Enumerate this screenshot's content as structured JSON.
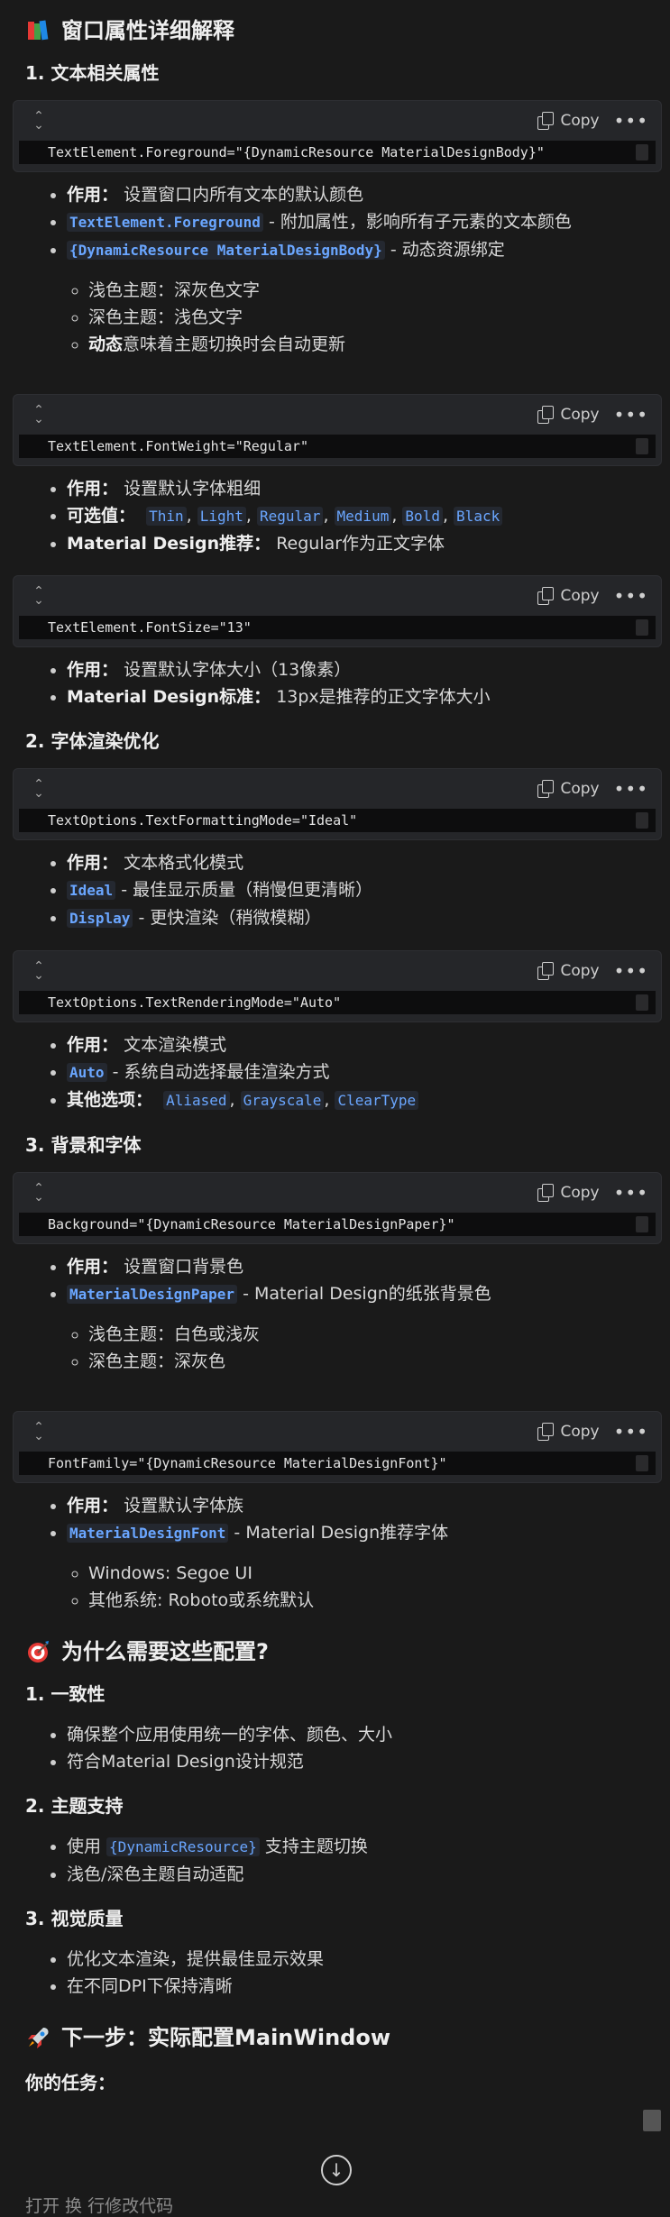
{
  "title": "窗口属性详细解释",
  "sections": {
    "s1": "1. 文本相关属性",
    "s2": "2. 字体渲染优化",
    "s3": "3. 背景和字体"
  },
  "code_ui": {
    "copy": "Copy",
    "more": "•••",
    "collapse": "⌄⌃"
  },
  "blocks": [
    {
      "code": "TextElement.Foreground=\"{DynamicResource MaterialDesignBody}\"",
      "items": [
        {
          "label": "作用：",
          "text": "设置窗口内所有文本的默认颜色"
        },
        {
          "code": "TextElement.Foreground",
          "text": " - 附加属性，影响所有子元素的文本颜色"
        },
        {
          "code": "{DynamicResource MaterialDesignBody}",
          "text": " - 动态资源绑定"
        }
      ],
      "sub": [
        "浅色主题：深灰色文字",
        "深色主题：浅色文字"
      ],
      "sub3_bold": "动态",
      "sub3_text": "意味着主题切换时会自动更新"
    },
    {
      "code": "TextElement.FontWeight=\"Regular\"",
      "items": [
        {
          "label": "作用：",
          "text": "设置默认字体粗细"
        },
        {
          "label": "可选值：",
          "values": [
            "Thin",
            "Light",
            "Regular",
            "Medium",
            "Bold",
            "Black"
          ]
        },
        {
          "label": "Material Design推荐：",
          "text": "Regular作为正文字体"
        }
      ]
    },
    {
      "code": "TextElement.FontSize=\"13\"",
      "items": [
        {
          "label": "作用：",
          "text": "设置默认字体大小（13像素）"
        },
        {
          "label": "Material Design标准：",
          "text": "13px是推荐的正文字体大小"
        }
      ]
    },
    {
      "code": "TextOptions.TextFormattingMode=\"Ideal\"",
      "items": [
        {
          "label": "作用：",
          "text": "文本格式化模式"
        },
        {
          "code": "Ideal",
          "text": " - 最佳显示质量（稍慢但更清晰）"
        },
        {
          "code": "Display",
          "text": " - 更快渲染（稍微模糊）"
        }
      ]
    },
    {
      "code": "TextOptions.TextRenderingMode=\"Auto\"",
      "items": [
        {
          "label": "作用：",
          "text": "文本渲染模式"
        },
        {
          "code": "Auto",
          "text": " - 系统自动选择最佳渲染方式"
        },
        {
          "label": "其他选项：",
          "values": [
            "Aliased",
            "Grayscale",
            "ClearType"
          ]
        }
      ]
    },
    {
      "code": "Background=\"{DynamicResource MaterialDesignPaper}\"",
      "items": [
        {
          "label": "作用：",
          "text": "设置窗口背景色"
        },
        {
          "code": "MaterialDesignPaper",
          "text": " - Material Design的纸张背景色"
        }
      ],
      "sub": [
        "浅色主题：白色或浅灰",
        "深色主题：深灰色"
      ]
    },
    {
      "code": "FontFamily=\"{DynamicResource MaterialDesignFont}\"",
      "items": [
        {
          "label": "作用：",
          "text": "设置默认字体族"
        },
        {
          "code": "MaterialDesignFont",
          "text": " - Material Design推荐字体"
        }
      ],
      "sub": [
        "Windows: Segoe UI",
        "其他系统: Roboto或系统默认"
      ]
    }
  ],
  "why": {
    "title": "为什么需要这些配置?",
    "h1": "1. 一致性",
    "h1_items": [
      "确保整个应用使用统一的字体、颜色、大小",
      "符合Material Design设计规范"
    ],
    "h2": "2. 主题支持",
    "h2_item1_pre": "使用 ",
    "h2_item1_code": "{DynamicResource}",
    "h2_item1_post": " 支持主题切换",
    "h2_item2": "浅色/深色主题自动适配",
    "h3": "3. 视觉质量",
    "h3_items": [
      "优化文本渲染，提供最佳显示效果",
      "在不同DPI下保持清晰"
    ]
  },
  "next": {
    "title": "下一步：实际配置MainWindow",
    "task": "你的任务："
  },
  "partial_bottom": "打开                  换           行修改代码"
}
